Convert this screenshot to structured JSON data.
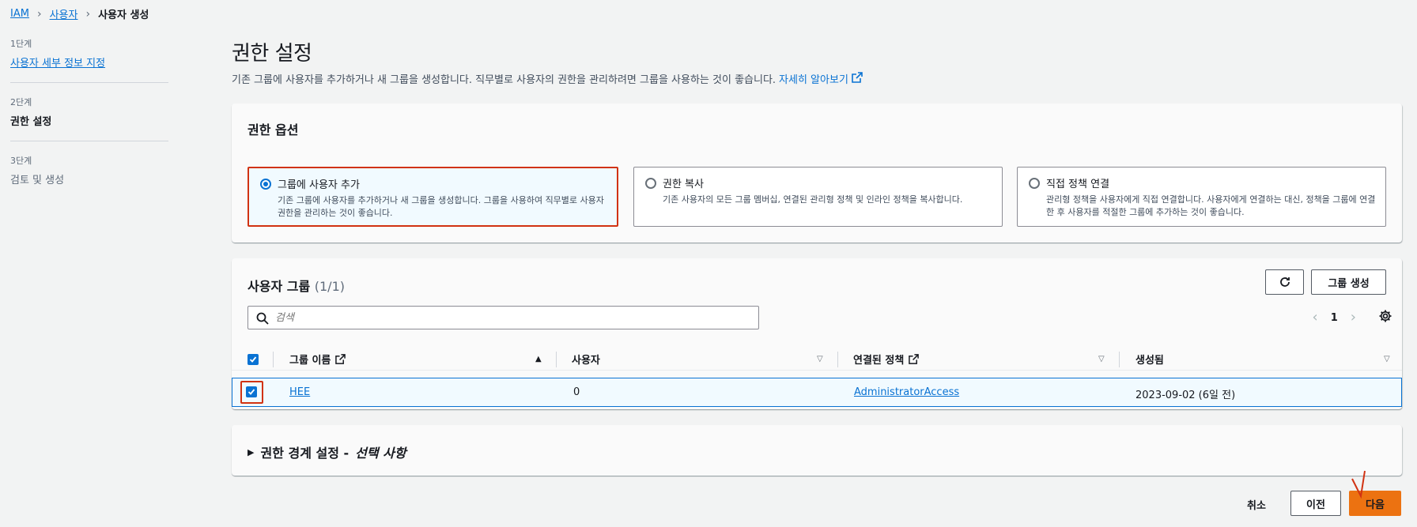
{
  "breadcrumb": {
    "items": [
      "IAM",
      "사용자",
      "사용자 생성"
    ]
  },
  "steps": [
    {
      "no": "1단계",
      "label": "사용자 세부 정보 지정"
    },
    {
      "no": "2단계",
      "label": "권한 설정"
    },
    {
      "no": "3단계",
      "label": "검토 및 생성"
    }
  ],
  "header": {
    "title": "권한 설정",
    "description": "기존 그룹에 사용자를 추가하거나 새 그룹을 생성합니다. 직무별로 사용자의 권한을 관리하려면 그룹을 사용하는 것이 좋습니다.",
    "learn_more": "자세히 알아보기"
  },
  "permission_options": {
    "title": "권한 옵션",
    "options": [
      {
        "title": "그룹에 사용자 추가",
        "desc": "기존 그룹에 사용자를 추가하거나 새 그룹을 생성합니다. 그룹을 사용하여 직무별로 사용자 권한을 관리하는 것이 좋습니다.",
        "selected": true
      },
      {
        "title": "권한 복사",
        "desc": "기존 사용자의 모든 그룹 멤버십, 연결된 관리형 정책 및 인라인 정책을 복사합니다.",
        "selected": false
      },
      {
        "title": "직접 정책 연결",
        "desc": "관리형 정책을 사용자에게 직접 연결합니다. 사용자에게 연결하는 대신, 정책을 그룹에 연결한 후 사용자를 적절한 그룹에 추가하는 것이 좋습니다.",
        "selected": false
      }
    ]
  },
  "groups": {
    "title": "사용자 그룹",
    "count": "(1/1)",
    "create_button": "그룹 생성",
    "search_placeholder": "검색",
    "page": "1",
    "columns": [
      "그룹 이름",
      "사용자",
      "연결된 정책",
      "생성됨"
    ],
    "rows": [
      {
        "name": "HEE",
        "users": "0",
        "policy": "AdministratorAccess",
        "created": "2023-09-02 (6일 전)",
        "checked": true
      }
    ]
  },
  "boundary": {
    "title": "권한 경계 설정 -",
    "optional": "선택 사항"
  },
  "footer": {
    "cancel": "취소",
    "prev": "이전",
    "next": "다음"
  },
  "colors": {
    "accent": "#0972d3",
    "primary_button": "#ec7211",
    "highlight_red": "#d13212"
  }
}
